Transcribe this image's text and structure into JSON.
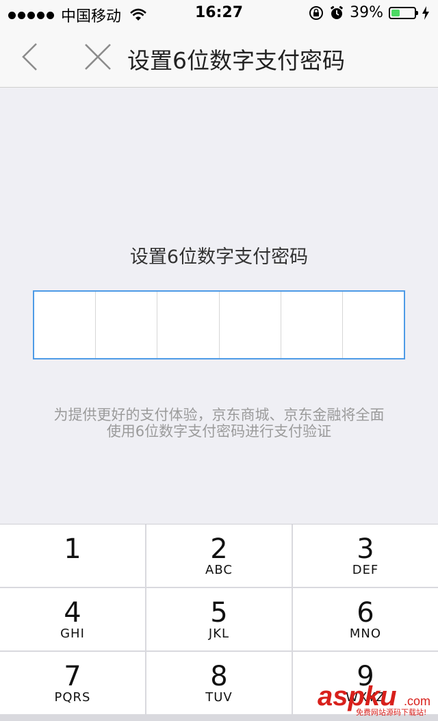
{
  "status_bar": {
    "carrier": "中国移动",
    "time": "16:27",
    "battery_percent": "39%",
    "battery_level": 0.39,
    "icons": [
      "signal-dots",
      "wifi-icon",
      "orientation-lock-icon",
      "alarm-icon",
      "battery-icon",
      "charging-bolt-icon"
    ]
  },
  "nav": {
    "title": "设置6位数字支付密码",
    "back_icon": "chevron-left-icon",
    "close_icon": "close-icon"
  },
  "main": {
    "prompt": "设置6位数字支付密码",
    "pin_length": 6,
    "notice_line1": "为提供更好的支付体验，京东商城、京东金融将全面",
    "notice_line2": "使用6位数字支付密码进行支付验证"
  },
  "keypad": {
    "keys": [
      {
        "num": "1",
        "letters": ""
      },
      {
        "num": "2",
        "letters": "ABC"
      },
      {
        "num": "3",
        "letters": "DEF"
      },
      {
        "num": "4",
        "letters": "GHI"
      },
      {
        "num": "5",
        "letters": "JKL"
      },
      {
        "num": "6",
        "letters": "MNO"
      },
      {
        "num": "7",
        "letters": "PQRS"
      },
      {
        "num": "8",
        "letters": "TUV"
      },
      {
        "num": "9",
        "letters": "WXYZ"
      }
    ]
  },
  "watermark": {
    "brand": "aspku",
    "domain": ".com",
    "tagline": "免费网站源码下载站!"
  },
  "colors": {
    "accent_border": "#4d9ae6",
    "battery_green": "#4cd964",
    "background": "#efeff4",
    "watermark_red": "#d8201b"
  }
}
